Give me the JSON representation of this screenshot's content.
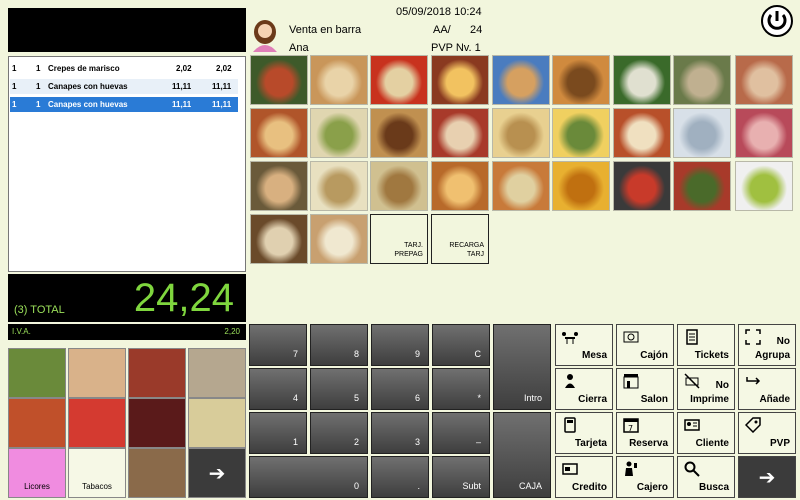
{
  "header": {
    "mode": "Venta en barra",
    "user": "Ana",
    "datetime": "05/09/2018 10:24",
    "aa_label": "AA/",
    "aa_value": "24",
    "pvp": "PVP Nv. 1"
  },
  "ticket": {
    "rows": [
      {
        "idx": "1",
        "qty": "1",
        "name": "Crepes de marisco",
        "price": "2,02",
        "total": "2,02"
      },
      {
        "idx": "1",
        "qty": "1",
        "name": "Canapes con huevas",
        "price": "11,11",
        "total": "11,11"
      },
      {
        "idx": "1",
        "qty": "1",
        "name": "Canapes con huevas",
        "price": "11,11",
        "total": "11,11"
      }
    ]
  },
  "totals": {
    "label": "(3) TOTAL",
    "value": "24,24",
    "iva_label": "I.V.A.",
    "iva_value": "2,20"
  },
  "products": {
    "tarj_prepag": "TARJ.\nPREPAG",
    "recarga_tarj": "RECARGA\nTARJ"
  },
  "families": {
    "licores": "Licores",
    "tabacos": "Tabacos"
  },
  "keypad": {
    "k7": "7",
    "k8": "8",
    "k9": "9",
    "kc": "C",
    "k4": "4",
    "k5": "5",
    "k6": "6",
    "kmul": "*",
    "k1": "1",
    "k2": "2",
    "k3": "3",
    "kminus": "–",
    "k0": "0",
    "kdot": ".",
    "subt": "Subt",
    "intro": "Intro",
    "caja": "CAJA"
  },
  "functions": {
    "mesa": "Mesa",
    "cajon": "Cajón",
    "tickets": "Tickets",
    "no_agrupa_1": "No",
    "no_agrupa_2": "Agrupa",
    "cierra": "Cierra",
    "salon": "Salon",
    "no_imprime_1": "No",
    "no_imprime_2": "Imprime",
    "anade": "Añade",
    "tarjeta": "Tarjeta",
    "reserva": "Reserva",
    "cliente": "Cliente",
    "pvp": "PVP",
    "credito": "Credito",
    "cajero": "Cajero",
    "busca": "Busca"
  },
  "icons": {
    "power": "power-icon",
    "arrow": "arrow-right-icon"
  }
}
